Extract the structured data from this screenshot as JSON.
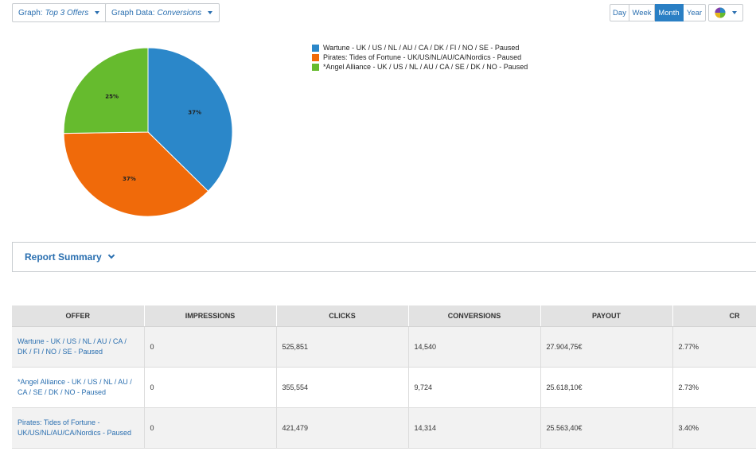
{
  "toolbar": {
    "graph_label": "Graph:",
    "graph_value": "Top 3 Offers",
    "graph_data_label": "Graph Data:",
    "graph_data_value": "Conversions",
    "ranges": [
      "Day",
      "Week",
      "Month",
      "Year"
    ],
    "active_range": "Month",
    "chart_type_icon": "pie-chart-icon"
  },
  "chart_data": {
    "type": "pie",
    "slices": [
      {
        "name": "Wartune - UK / US / NL / AU / CA / DK / FI / NO / SE - Paused",
        "value": 37,
        "label": "37%",
        "color": "#2b87c9"
      },
      {
        "name": "Pirates: Tides of Fortune - UK/US/NL/AU/CA/Nordics - Paused",
        "value": 37,
        "label": "37%",
        "color": "#f06a0a"
      },
      {
        "name": "*Angel Alliance - UK / US / NL / AU / CA / SE / DK / NO - Paused",
        "value": 25,
        "label": "25%",
        "color": "#66bb2e"
      }
    ],
    "legend_position": "top-right"
  },
  "summary": {
    "title": "Report Summary"
  },
  "table": {
    "headers": [
      "OFFER",
      "IMPRESSIONS",
      "CLICKS",
      "CONVERSIONS",
      "PAYOUT",
      "CR"
    ],
    "rows": [
      {
        "offer": "Wartune - UK / US / NL / AU / CA / DK / FI / NO / SE - Paused",
        "impressions": "0",
        "clicks": "525,851",
        "conversions": "14,540",
        "payout": "27.904,75€",
        "cr": "2.77%"
      },
      {
        "offer": "*Angel Alliance - UK / US / NL / AU / CA / SE / DK / NO - Paused",
        "impressions": "0",
        "clicks": "355,554",
        "conversions": "9,724",
        "payout": "25.618,10€",
        "cr": "2.73%"
      },
      {
        "offer": "Pirates: Tides of Fortune - UK/US/NL/AU/CA/Nordics - Paused",
        "impressions": "0",
        "clicks": "421,479",
        "conversions": "14,314",
        "payout": "25.563,40€",
        "cr": "3.40%"
      }
    ]
  }
}
